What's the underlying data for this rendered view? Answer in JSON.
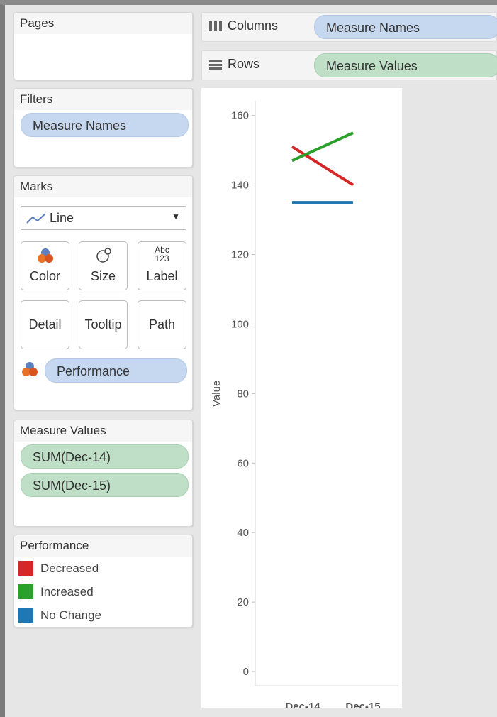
{
  "pages_card": {
    "title": "Pages"
  },
  "shelves": {
    "columns": {
      "label": "Columns",
      "pill": "Measure Names"
    },
    "rows": {
      "label": "Rows",
      "pill": "Measure Values"
    }
  },
  "filters_card": {
    "title": "Filters",
    "pills": [
      "Measure Names"
    ]
  },
  "marks_card": {
    "title": "Marks",
    "mark_type": "Line",
    "buttons": {
      "color": "Color",
      "size": "Size",
      "label": "Label",
      "label_icon_top": "Abc",
      "label_icon_bottom": "123",
      "detail": "Detail",
      "tooltip": "Tooltip",
      "path": "Path"
    },
    "color_field": "Performance"
  },
  "measure_values_card": {
    "title": "Measure Values",
    "pills": [
      "SUM(Dec-14)",
      "SUM(Dec-15)"
    ]
  },
  "legend": {
    "title": "Performance",
    "items": [
      {
        "label": "Decreased",
        "color": "#d62728"
      },
      {
        "label": "Increased",
        "color": "#2ca02c"
      },
      {
        "label": "No Change",
        "color": "#1f77b4"
      }
    ]
  },
  "chart_data": {
    "type": "line",
    "title": "",
    "xlabel": "",
    "ylabel": "Value",
    "x": [
      "Dec-14",
      "Dec-15"
    ],
    "ylim": [
      0,
      163
    ],
    "yticks": [
      0,
      20,
      40,
      60,
      80,
      100,
      120,
      140,
      160
    ],
    "grid": false,
    "series": [
      {
        "name": "Decreased",
        "color": "#d62728",
        "values": [
          151,
          140
        ]
      },
      {
        "name": "Increased",
        "color": "#2ca02c",
        "values": [
          147,
          155
        ]
      },
      {
        "name": "No Change",
        "color": "#1f77b4",
        "values": [
          135,
          135
        ]
      }
    ]
  }
}
